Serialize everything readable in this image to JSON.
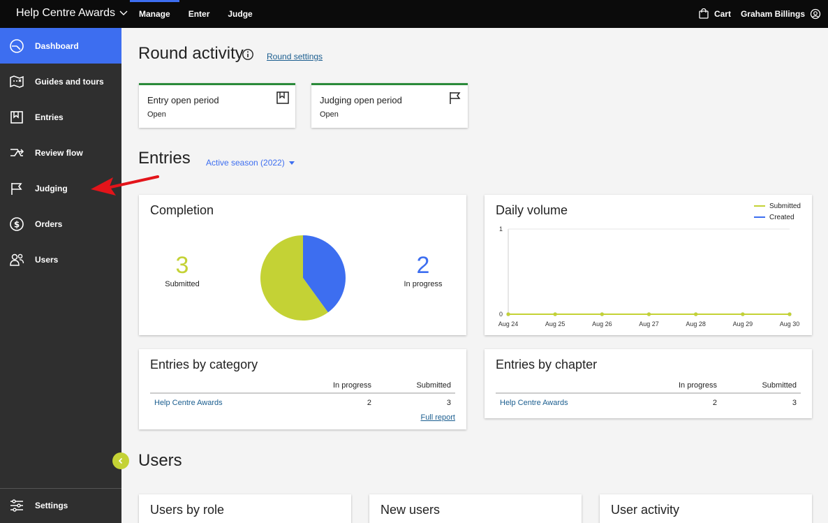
{
  "header": {
    "app_name": "Help Centre Awards",
    "nav": [
      "Manage",
      "Enter",
      "Judge"
    ],
    "cart_label": "Cart",
    "user_name": "Graham Billings"
  },
  "sidebar": {
    "items": [
      {
        "label": "Dashboard",
        "icon": "dashboard-icon",
        "active": true
      },
      {
        "label": "Guides and tours",
        "icon": "map-icon"
      },
      {
        "label": "Entries",
        "icon": "entries-icon"
      },
      {
        "label": "Review flow",
        "icon": "review-flow-icon"
      },
      {
        "label": "Judging",
        "icon": "flag-icon"
      },
      {
        "label": "Orders",
        "icon": "dollar-icon"
      },
      {
        "label": "Users",
        "icon": "users-icon"
      }
    ],
    "settings_label": "Settings"
  },
  "round": {
    "title": "Round activity",
    "settings_link": "Round settings",
    "periods": [
      {
        "title": "Entry open period",
        "status": "Open",
        "icon": "bookmark-icon"
      },
      {
        "title": "Judging open period",
        "status": "Open",
        "icon": "flag-icon"
      }
    ]
  },
  "entries": {
    "title": "Entries",
    "season": "Active season (2022)",
    "completion": {
      "title": "Completion",
      "submitted_count": "3",
      "submitted_label": "Submitted",
      "in_progress_count": "2",
      "in_progress_label": "In progress"
    },
    "daily_volume": {
      "title": "Daily volume"
    },
    "by_category": {
      "title": "Entries by category",
      "headers": [
        "In progress",
        "Submitted"
      ],
      "rows": [
        {
          "name": "Help Centre Awards",
          "in_progress": "2",
          "submitted": "3"
        }
      ],
      "full_report": "Full report"
    },
    "by_chapter": {
      "title": "Entries by chapter",
      "headers": [
        "In progress",
        "Submitted"
      ],
      "rows": [
        {
          "name": "Help Centre Awards",
          "in_progress": "2",
          "submitted": "3"
        }
      ]
    }
  },
  "users": {
    "title": "Users",
    "cards": [
      "Users by role",
      "New users",
      "User activity"
    ]
  },
  "colors": {
    "accent": "#3d6ef0",
    "submitted": "#c4d235",
    "in_progress": "#3d6ef0",
    "period_border": "#2a8a3a",
    "annotation_arrow": "#e3141a"
  },
  "chart_data": [
    {
      "type": "pie",
      "title": "Completion",
      "categories": [
        "Submitted",
        "In progress"
      ],
      "values": [
        3,
        2
      ],
      "colors": [
        "#c4d235",
        "#3d6ef0"
      ]
    },
    {
      "type": "line",
      "title": "Daily volume",
      "x": [
        "Aug 24",
        "Aug 25",
        "Aug 26",
        "Aug 27",
        "Aug 28",
        "Aug 29",
        "Aug 30"
      ],
      "series": [
        {
          "name": "Submitted",
          "values": [
            0,
            0,
            0,
            0,
            0,
            0,
            0
          ],
          "color": "#c4d235"
        },
        {
          "name": "Created",
          "values": [
            0,
            0,
            0,
            0,
            0,
            0,
            0
          ],
          "color": "#3d6ef0"
        }
      ],
      "yticks": [
        "1",
        "0"
      ],
      "ylim": [
        0,
        1
      ],
      "legend": "top-right",
      "grid": true
    }
  ]
}
